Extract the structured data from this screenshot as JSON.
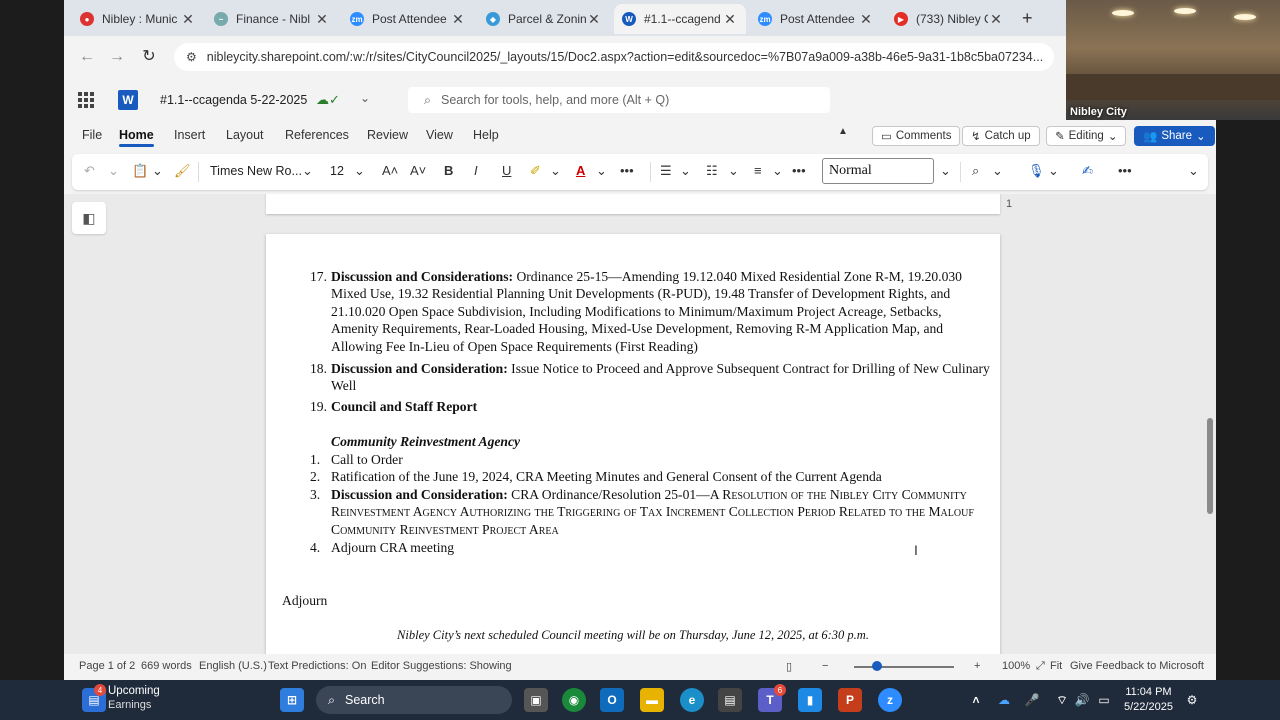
{
  "browser": {
    "tabs": [
      {
        "title": "Nibley : Munic",
        "icon_color": "#d33"
      },
      {
        "title": "Finance - Nibl",
        "icon_color": "#7aa"
      },
      {
        "title": "Post Attendee",
        "icon_color": "#2d8cff"
      },
      {
        "title": "Parcel & Zonin",
        "icon_color": "#3a9ad9"
      },
      {
        "title": "#1.1--ccagend",
        "icon_color": "#185abd"
      },
      {
        "title": "Post Attendee",
        "icon_color": "#2d8cff"
      },
      {
        "title": "(733) Nibley C",
        "icon_color": "#e52d27"
      }
    ],
    "active_tab_index": 4,
    "new_tab_glyph": "+",
    "url": "nibleycity.sharepoint.com/:w:/r/sites/CityCouncil2025/_layouts/15/Doc2.aspx?action=edit&sourcedoc=%7B07a9a009-a38b-46e5-9a31-1b8c5ba07234..."
  },
  "video": {
    "label": "Nibley City"
  },
  "word": {
    "logo": "W",
    "doc_title": "#1.1--ccagenda 5-22-2025",
    "search_placeholder": "Search for tools, help, and more (Alt + Q)",
    "menu": [
      "File",
      "Home",
      "Insert",
      "Layout",
      "References",
      "Review",
      "View",
      "Help"
    ],
    "active_menu": "Home",
    "comments": "Comments",
    "catch_up": "Catch up",
    "editing": "Editing",
    "share": "Share",
    "font_name": "Times New Ro...",
    "font_size": "12",
    "style": "Normal"
  },
  "document": {
    "page_marker": "1",
    "items": [
      {
        "num": "17.",
        "bold": "Discussion and Considerations:",
        "text": " Ordinance 25-15—Amending 19.12.040 Mixed Residential Zone R-M, 19.20.030 Mixed Use, 19.32 Residential Planning Unit Developments (R-PUD), 19.48 Transfer of Development Rights, and 21.10.020 Open Space Subdivision, Including Modifications to Minimum/Maximum Project Acreage, Setbacks, Amenity Requirements, Rear-Loaded Housing, Mixed-Use Development, Removing R-M Application Map, and Allowing Fee In-Lieu of Open Space Requirements (First Reading)"
      },
      {
        "num": "18.",
        "bold": "Discussion and Consideration:",
        "text": "  Issue Notice to Proceed and Approve Subsequent Contract for Drilling of New Culinary Well"
      },
      {
        "num": "19.",
        "bold": "Council and Staff Report",
        "text": ""
      }
    ],
    "cra_heading": "Community Reinvestment Agency",
    "cra_items": [
      {
        "num": "1.",
        "text": "Call to Order"
      },
      {
        "num": "2.",
        "text": "Ratification of the June 19, 2024, CRA Meeting Minutes and General Consent of the Current Agenda"
      },
      {
        "num": "3.",
        "bold": "Discussion and Consideration:",
        "text": " CRA Ordinance/Resolution 25-01—",
        "smallcaps": "A Resolution of the Nibley City Community Reinvestment Agency Authorizing the Triggering of Tax Increment Collection Period Related to the Malouf Community Reinvestment Project Area"
      },
      {
        "num": "4.",
        "text": "Adjourn CRA meeting"
      }
    ],
    "adjourn": "Adjourn",
    "next_meeting": "Nibley City’s next scheduled Council meeting will be on Thursday, June 12, 2025, at 6:30 p.m."
  },
  "status": {
    "page": "Page 1 of 2",
    "words": "669 words",
    "language": "English (U.S.)",
    "predictions": "Text Predictions: On",
    "editor": "Editor Suggestions: Showing",
    "zoom": "100%",
    "fit": "Fit",
    "feedback": "Give Feedback to Microsoft"
  },
  "taskbar": {
    "widget_badge": "4",
    "widget_title": "Upcoming",
    "widget_sub": "Earnings",
    "search": "Search",
    "teams_badge": "6",
    "time": "11:04 PM",
    "date": "5/22/2025"
  }
}
